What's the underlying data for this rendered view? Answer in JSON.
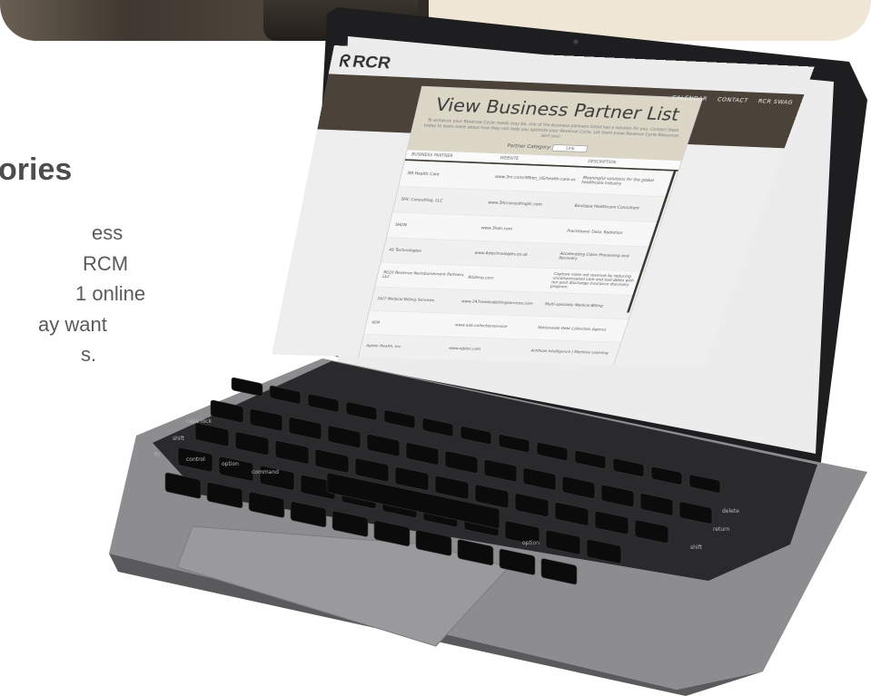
{
  "background": {
    "left_heading": "ories",
    "left_lines": [
      "ess",
      "RCM",
      "1 online",
      "ay want",
      "s."
    ]
  },
  "website": {
    "logo": "RCR",
    "nav": [
      "CALENDAR",
      "CONTACT",
      "RCR SWAG"
    ],
    "title": "View Business Partner List",
    "intro": "To enhance your Revenue Cycle needs may be, one of the business partners listed has a solution for you. Contact them today to learn more about how they can help you optimize your Revenue Cycle. Let them know Revenue Cycle Resources sent you!",
    "category_label": "Partner Category:",
    "category_value": "Link",
    "columns": [
      "BUSINESS PARTNER",
      "WEBSITE",
      "DESCRIPTION"
    ],
    "rows": [
      {
        "partner": "3M Health Care",
        "website": "www.3m.com/3M/en_US/health-care-us",
        "description": "Meaningful solutions for the global healthcare industry"
      },
      {
        "partner": "3HC Consulting, LLC",
        "website": "www.3hcconsultingllc.com",
        "description": "Boutique Healthcare Consultant"
      },
      {
        "partner": "3HDN",
        "website": "www.3hdn.com",
        "description": "Practitioner Data, Radiation"
      },
      {
        "partner": "4S Technologies",
        "website": "www.4stechnologies.co.uk",
        "description": "Accelerating Claim Processing and Recovery"
      },
      {
        "partner": "8020 Revenue Reimbursement Partners, LLC",
        "website": "8020rrp.com",
        "description": "Capture more net revenue by reducing uncompensated care and bad debts with our post discharge insurance discovery program."
      },
      {
        "partner": "24/7 Medical Billing Services",
        "website": "www.247medicalbillingservices.com",
        "description": "Multi-specialty Medical Billing"
      },
      {
        "partner": "ADA",
        "website": "www.ada-collectionservice",
        "description": "Nationwide Debt Collection Agency"
      },
      {
        "partner": "Agilon Health, Inc.",
        "website": "www.agilon.com",
        "description": "Artificial Intelligence | Machine Learning"
      }
    ]
  },
  "keyboard": {
    "key_labels": [
      "caps lock",
      "shift",
      "fn",
      "control",
      "option",
      "command",
      "delete",
      "return",
      "shift",
      "option"
    ]
  }
}
